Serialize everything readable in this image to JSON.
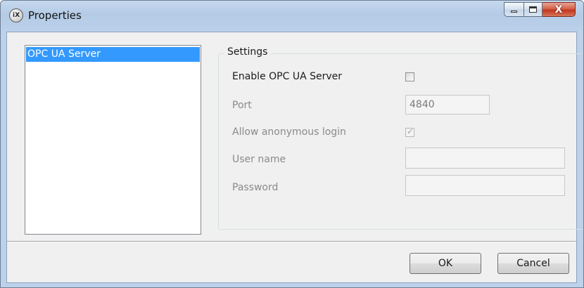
{
  "window": {
    "title": "Properties",
    "app_icon_text": "iX",
    "controls": {
      "minimize": "minimize",
      "maximize": "maximize",
      "close": "X"
    }
  },
  "nav": {
    "items": [
      {
        "label": "OPC UA Server",
        "selected": true
      }
    ]
  },
  "settings": {
    "legend": "Settings",
    "enable_label": "Enable OPC UA Server",
    "enable_checked": false,
    "port_label": "Port",
    "port_value": "4840",
    "anon_label": "Allow anonymous login",
    "anon_checked": true,
    "username_label": "User name",
    "username_value": "",
    "password_label": "Password",
    "password_value": ""
  },
  "buttons": {
    "ok": "OK",
    "cancel": "Cancel"
  },
  "colors": {
    "selection": "#3399ff",
    "disabled_text": "#8a8a8a",
    "close_button": "#c2361c",
    "titlebar": "#b4cbe6"
  }
}
